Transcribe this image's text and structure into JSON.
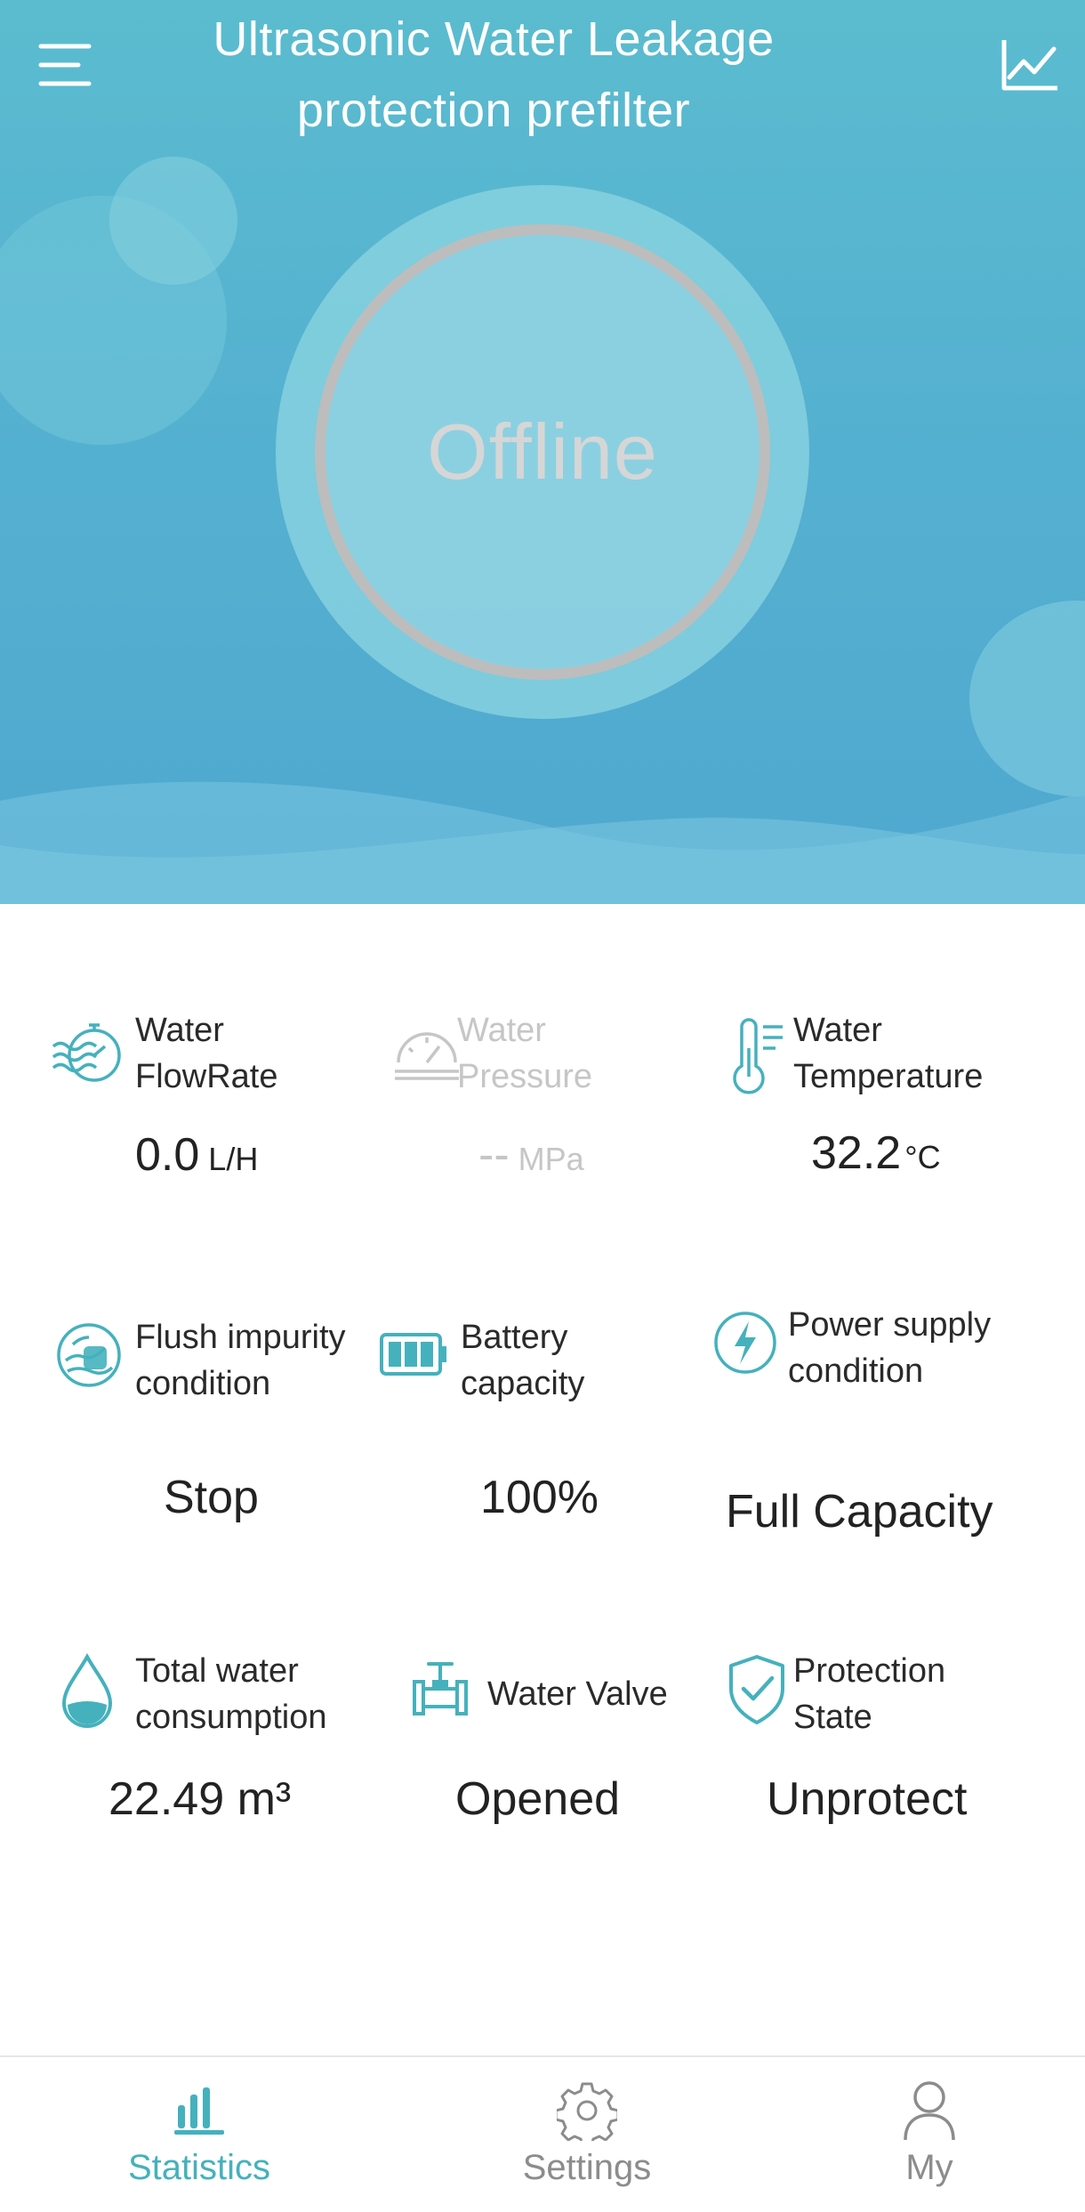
{
  "header": {
    "title_line1": "Ultrasonic Water Leakage",
    "title_line2": "protection prefilter",
    "menu_icon": "menu-icon",
    "chart_icon": "line-chart-icon"
  },
  "status": {
    "text": "Offline"
  },
  "stats": {
    "flow": {
      "label_line1": "Water",
      "label_line2": "FlowRate",
      "value": "0.0",
      "unit": "L/H",
      "icon": "water-flow-icon"
    },
    "pressure": {
      "label_line1": "Water",
      "label_line2": "Pressure",
      "value": "--",
      "unit": "MPa",
      "icon": "pressure-gauge-icon"
    },
    "temperature": {
      "label_line1": "Water",
      "label_line2": "Temperature",
      "value": "32.2",
      "unit": "°C",
      "icon": "thermometer-icon"
    },
    "flush": {
      "label_line1": "Flush impurity",
      "label_line2": "condition",
      "value": "Stop",
      "icon": "flush-icon"
    },
    "battery": {
      "label_line1": "Battery",
      "label_line2": "capacity",
      "value": "100%",
      "icon": "battery-icon"
    },
    "power": {
      "label_line1": "Power supply",
      "label_line2": "condition",
      "value": "Full Capacity",
      "icon": "lightning-icon"
    },
    "consumption": {
      "label_line1": "Total water",
      "label_line2": "consumption",
      "value": "22.49 m³",
      "icon": "water-drop-icon"
    },
    "valve": {
      "label": "Water Valve",
      "value": "Opened",
      "icon": "valve-icon"
    },
    "protection": {
      "label_line1": "Protection",
      "label_line2": "State",
      "value": "Unprotect",
      "icon": "shield-check-icon"
    }
  },
  "nav": {
    "items": [
      {
        "label": "Statistics",
        "icon": "bar-chart-icon",
        "active": true
      },
      {
        "label": "Settings",
        "icon": "gear-icon",
        "active": false
      },
      {
        "label": "My",
        "icon": "user-icon",
        "active": false
      }
    ]
  },
  "colors": {
    "accent": "#45b1bd",
    "hero_top": "#5bbccf",
    "hero_bottom": "#4fa8d0",
    "inactive_text": "#c6c6c6",
    "nav_inactive": "#8c8c8c"
  }
}
